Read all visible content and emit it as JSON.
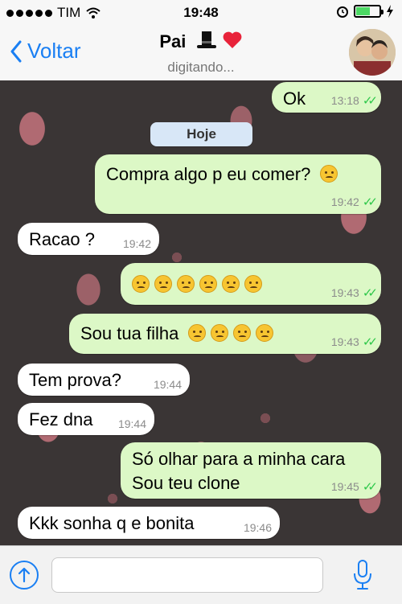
{
  "status": {
    "carrier": "TIM",
    "time": "19:48"
  },
  "header": {
    "back_label": "Voltar",
    "contact_name": "Pai",
    "status": "digitando..."
  },
  "day_badge": "Hoje",
  "messages": [
    {
      "side": "out",
      "text": "Ok",
      "time": "13:18",
      "emojis": 0
    },
    {
      "side": "out",
      "text": "Compra algo p eu comer?",
      "time": "19:42",
      "emojis": 1
    },
    {
      "side": "in",
      "text": "Racao ?",
      "time": "19:42",
      "emojis": 0
    },
    {
      "side": "out",
      "text": "",
      "time": "19:43",
      "emojis": 6
    },
    {
      "side": "out",
      "text": "Sou tua filha",
      "time": "19:43",
      "emojis": 4
    },
    {
      "side": "in",
      "text": "Tem prova?",
      "time": "19:44",
      "emojis": 0
    },
    {
      "side": "in",
      "text": "Fez dna",
      "time": "19:44",
      "emojis": 0
    },
    {
      "side": "out",
      "text": "Só olhar para a minha cara",
      "text2": "Sou teu clone",
      "time": "19:45",
      "emojis": 0
    },
    {
      "side": "in",
      "text": "Kkk sonha q e bonita",
      "time": "19:46",
      "emojis": 0
    }
  ],
  "input": {
    "placeholder": ""
  },
  "colors": {
    "accent": "#1a7ff3",
    "outgoing_bubble": "#dcf8c6",
    "incoming_bubble": "#ffffff",
    "read_ticks": "#2ec84a"
  },
  "icons": [
    "signal-dots-icon",
    "wifi-icon",
    "alarm-icon",
    "battery-icon",
    "charging-icon",
    "back-chevron-icon",
    "top-hat-icon",
    "heart-icon",
    "upload-icon",
    "microphone-icon"
  ]
}
